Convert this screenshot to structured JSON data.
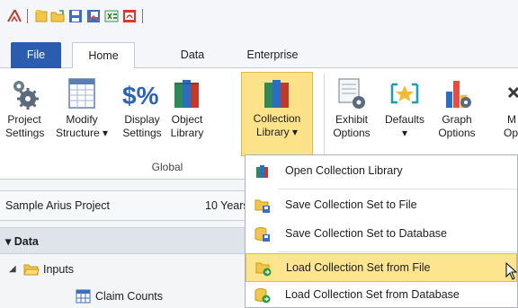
{
  "tabs": [
    "File",
    "Home",
    "Data",
    "Enterprise"
  ],
  "ribbon": {
    "buttons": [
      {
        "line1": "Project",
        "line2": "Settings",
        "icon": "gear-icon"
      },
      {
        "line1": "Modify",
        "line2": "Structure ▾",
        "icon": "table-icon"
      },
      {
        "line1": "Display",
        "line2": "Settings",
        "icon": "dollar-percent-icon"
      },
      {
        "line1": "Object",
        "line2": "Library",
        "icon": "books-icon"
      },
      {
        "line1": "Collection",
        "line2": "Library ▾",
        "icon": "books-icon"
      },
      {
        "line1": "Exhibit",
        "line2": "Options",
        "icon": "exhibit-gear-icon"
      },
      {
        "line1": "Defaults",
        "line2": "▾",
        "icon": "star-icon"
      },
      {
        "line1": "Graph",
        "line2": "Options",
        "icon": "bar-chart-icon"
      },
      {
        "line1": "M",
        "line2": "Op",
        "icon": "close-icon"
      }
    ],
    "group_label": "Global"
  },
  "panel": {
    "project_name": "Sample Arius Project",
    "years": "10 Years",
    "section": "Data",
    "tree": [
      {
        "label": "Inputs"
      },
      {
        "label": "Claim Counts"
      }
    ]
  },
  "menu": {
    "items": [
      {
        "label": "Open Collection Library",
        "icon": "books-icon"
      },
      {
        "label": "Save Collection Set to File",
        "icon": "save-file-icon"
      },
      {
        "label": "Save Collection Set to Database",
        "icon": "save-database-icon"
      },
      {
        "label": "Load Collection Set from File",
        "icon": "load-file-icon"
      },
      {
        "label": "Load Collection Set from Database",
        "icon": "load-database-icon"
      }
    ],
    "highlighted_index": 3
  },
  "colors": {
    "accent": "#2a5db0",
    "highlight": "#fde58f",
    "highlight_border": "#e8b94a"
  }
}
